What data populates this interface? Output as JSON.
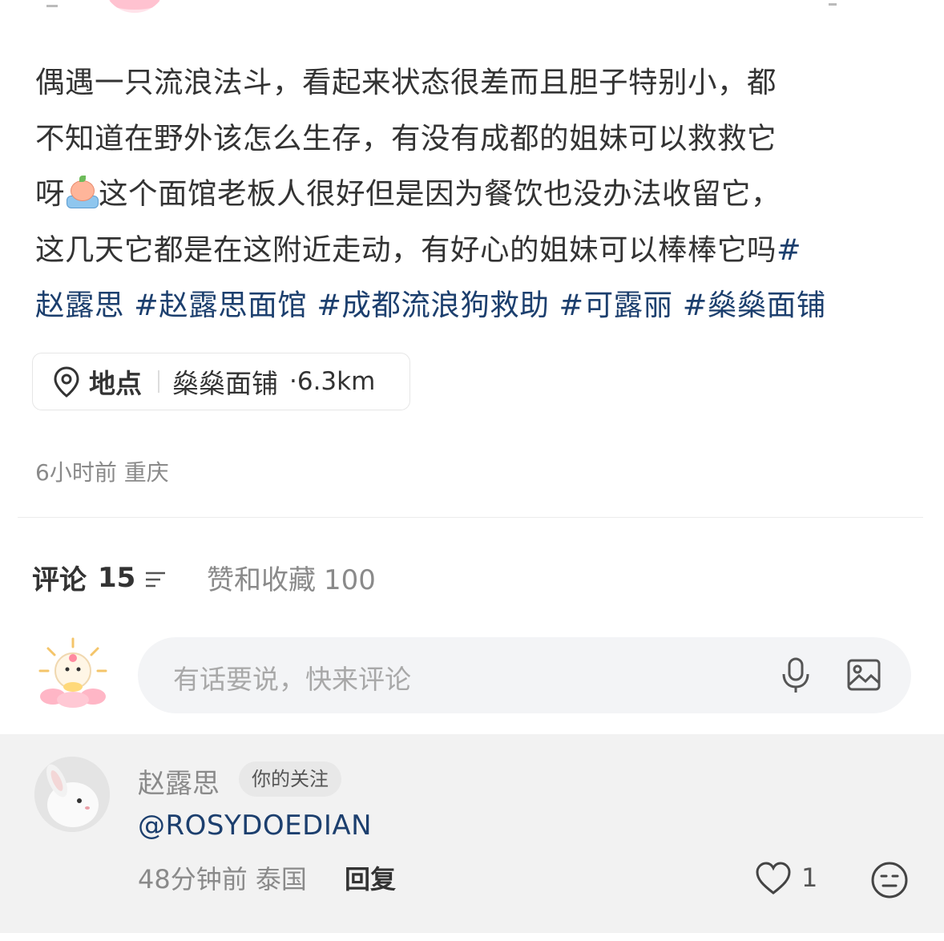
{
  "post": {
    "line1": "偶遇一只流浪法斗，看起来状态很差而且胆子特别小，都",
    "line2": "不知道在野外该怎么生存，有没有成都的姐妹可以救救它",
    "line3_pre": "呀",
    "line3_post": "这个面馆老板人很好但是因为餐饮也没办法收留它，",
    "line4": "这几天它都是在这附近走动，有好心的姐妹可以棒棒它吗",
    "line4_hash": "#",
    "tags": [
      "赵露思",
      "#赵露思面馆",
      "#成都流浪狗救助",
      "#可露丽",
      "#燊燊面铺"
    ]
  },
  "location": {
    "label": "地点",
    "place": "燊燊面铺",
    "distance": "·6.3km"
  },
  "meta": {
    "time": "6小时前",
    "region": "重庆"
  },
  "comments_header": {
    "comments_label": "评论",
    "comments_count": "15",
    "likes_label": "赞和收藏",
    "likes_count": "100"
  },
  "comment_input": {
    "placeholder": "有话要说，快来评论"
  },
  "comment": {
    "username": "赵露思",
    "badge": "你的关注",
    "text": "@ROSYDOEDIAN",
    "time": "48分钟前",
    "region": "泰国",
    "reply_label": "回复",
    "like_count": "1"
  },
  "colors": {
    "tag_blue": "#1c3f6e",
    "muted_gray": "#8a8a8a",
    "input_bg": "#f3f4f6",
    "comment_highlight_bg": "#f2f2f2"
  },
  "icons": [
    "location-pin-icon",
    "sort-icon",
    "microphone-icon",
    "image-icon",
    "heart-icon",
    "face-emoji-icon",
    "crying-peach-emoji"
  ]
}
